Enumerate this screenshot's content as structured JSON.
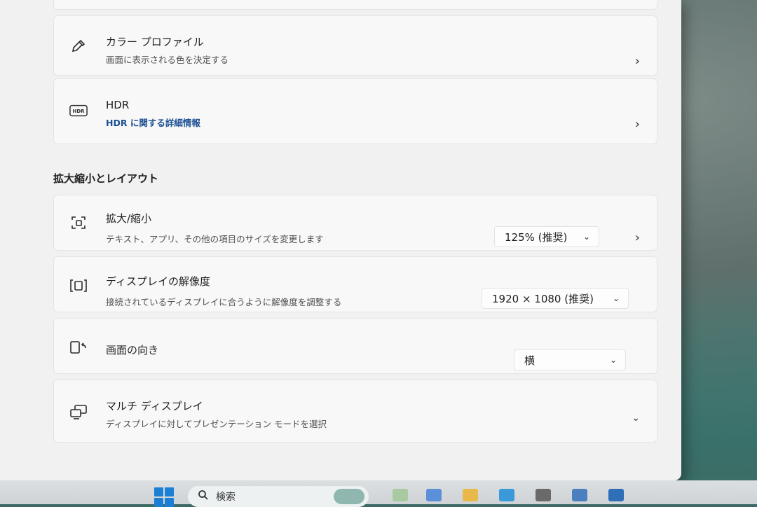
{
  "color_profile": {
    "title": "カラー プロファイル",
    "subtitle": "画面に表示される色を決定する"
  },
  "hdr": {
    "title": "HDR",
    "link": "HDR に関する詳細情報"
  },
  "section": {
    "heading": "拡大縮小とレイアウト"
  },
  "scale": {
    "title": "拡大/縮小",
    "subtitle": "テキスト、アプリ、その他の項目のサイズを変更します",
    "value": "125% (推奨)"
  },
  "resolution": {
    "title": "ディスプレイの解像度",
    "subtitle": "接続されているディスプレイに合うように解像度を調整する",
    "value": "1920 × 1080 (推奨)"
  },
  "orientation": {
    "title": "画面の向き",
    "value": "横"
  },
  "multi_display": {
    "title": "マルチ ディスプレイ",
    "subtitle": "ディスプレイに対してプレゼンテーション モードを選択"
  },
  "taskbar": {
    "search_placeholder": "検索"
  },
  "icons": {
    "chevron_right": "›",
    "chevron_down": "⌄"
  },
  "colors": {
    "accent_link": "#1c4f94",
    "windows_logo": "#1b7fd6"
  }
}
